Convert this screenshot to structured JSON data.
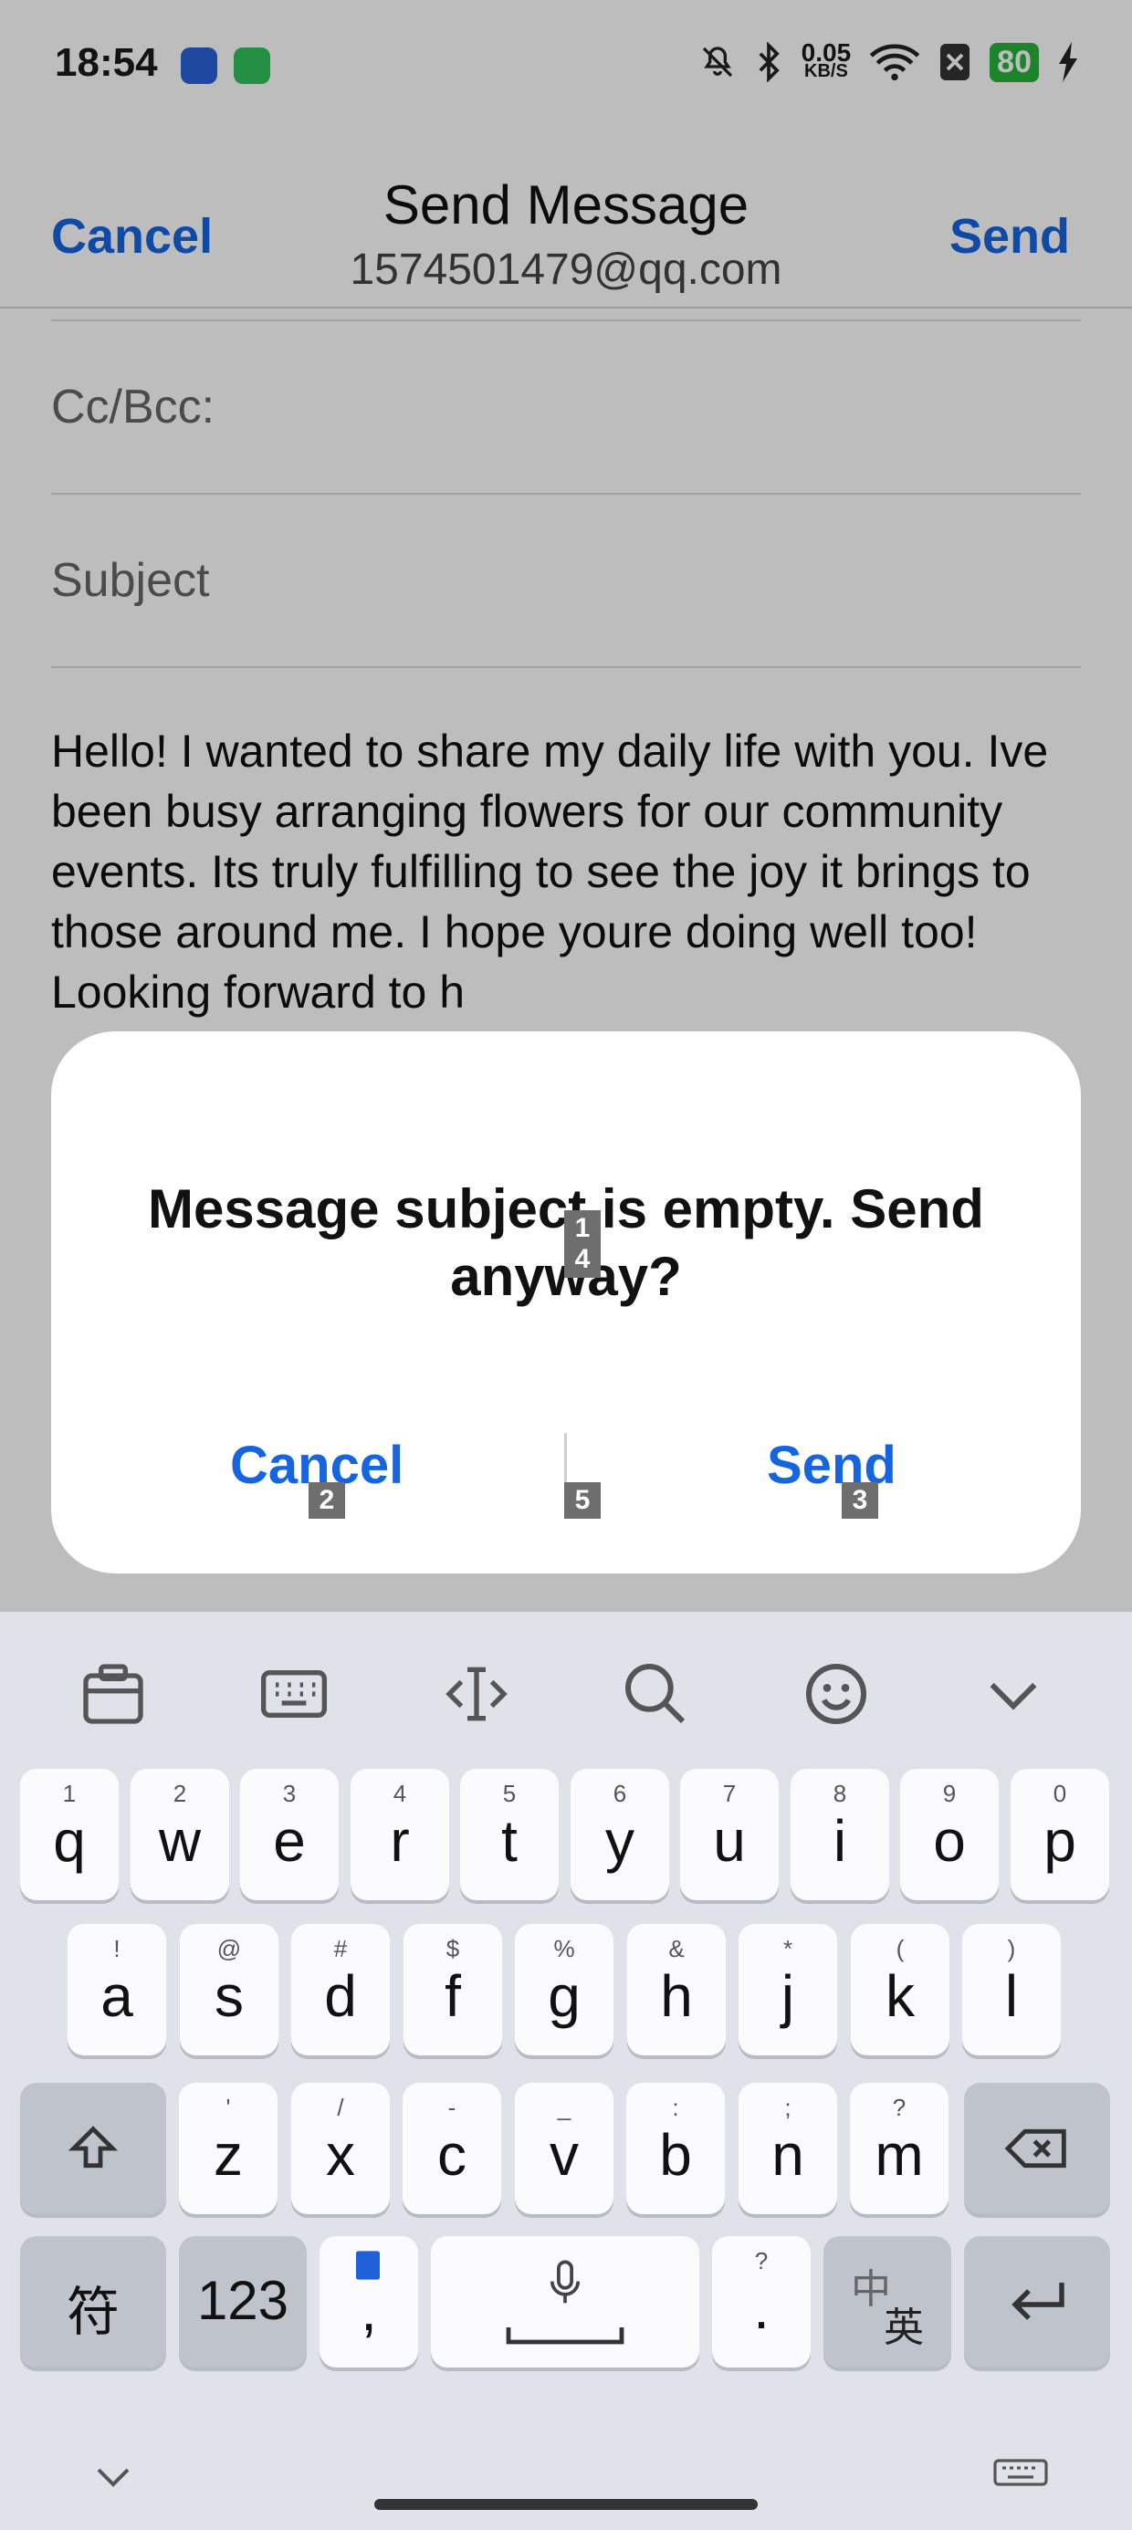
{
  "status": {
    "time": "18:54",
    "net_speed": "0.05",
    "net_unit": "KB/S",
    "battery": "80"
  },
  "header": {
    "cancel": "Cancel",
    "title": "Send Message",
    "account": "1574501479@qq.com",
    "send": "Send"
  },
  "form": {
    "cc_label": "Cc/Bcc:",
    "subject_placeholder": "Subject",
    "body": "Hello! I wanted to share my daily life with you. Ive been busy arranging flowers for our community events. Its truly fulfilling to see the joy it brings to those around me. I hope youre doing well too! Looking forward to h"
  },
  "dialog": {
    "message": "Message subject is empty. Send anyway?",
    "cancel": "Cancel",
    "send": "Send",
    "markers": [
      "1",
      "4",
      "2",
      "5",
      "3"
    ]
  },
  "keyboard": {
    "row1": [
      [
        "1",
        "q"
      ],
      [
        "2",
        "w"
      ],
      [
        "3",
        "e"
      ],
      [
        "4",
        "r"
      ],
      [
        "5",
        "t"
      ],
      [
        "6",
        "y"
      ],
      [
        "7",
        "u"
      ],
      [
        "8",
        "i"
      ],
      [
        "9",
        "o"
      ],
      [
        "0",
        "p"
      ]
    ],
    "row2": [
      [
        "!",
        "a"
      ],
      [
        "@",
        "s"
      ],
      [
        "#",
        "d"
      ],
      [
        "$",
        "f"
      ],
      [
        "%",
        "g"
      ],
      [
        "&",
        "h"
      ],
      [
        "*",
        "j"
      ],
      [
        "(",
        "k"
      ],
      [
        ")",
        "l"
      ]
    ],
    "row3": [
      [
        "'",
        "z"
      ],
      [
        "/",
        "x"
      ],
      [
        "-",
        "c"
      ],
      [
        "_",
        "v"
      ],
      [
        ":",
        "b"
      ],
      [
        ";",
        "n"
      ],
      [
        "?",
        "m"
      ]
    ],
    "symbols_key": "符",
    "numbers_key": "123",
    "comma_key": ",",
    "period_key": ".",
    "period_sub": "?",
    "lang_key_top": "中",
    "lang_key_bottom": "英"
  }
}
